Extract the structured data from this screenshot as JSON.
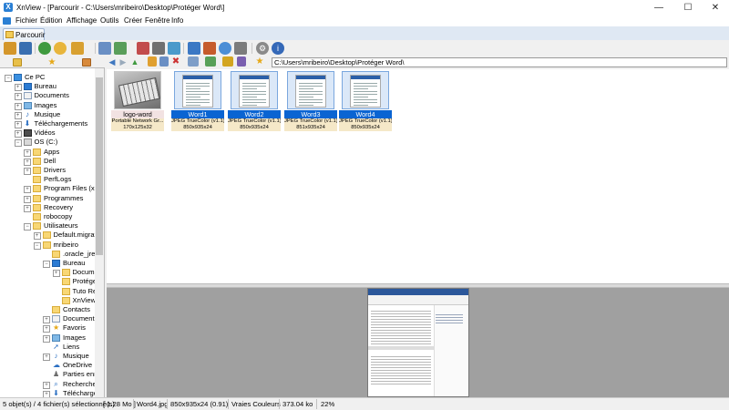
{
  "window": {
    "title": "XnView - [Parcourir - C:\\Users\\mribeiro\\Desktop\\Protéger Word\\]",
    "minimize_glyph": "—",
    "maximize_glyph": "☐",
    "close_glyph": "✕"
  },
  "menu": [
    "Fichier",
    "Édition",
    "Affichage",
    "Outils",
    "Créer",
    "Fenêtre",
    "Info"
  ],
  "tab": {
    "label": "Parcourir"
  },
  "address": {
    "path": "C:\\Users\\mribeiro\\Desktop\\Protéger Word\\"
  },
  "tree": [
    {
      "label": "Ce PC",
      "depth": 0,
      "icon": "computer-icon",
      "exp": "−"
    },
    {
      "label": "Bureau",
      "depth": 1,
      "icon": "desktop-icon",
      "exp": "+"
    },
    {
      "label": "Documents",
      "depth": 1,
      "icon": "documents-icon",
      "exp": "+"
    },
    {
      "label": "Images",
      "depth": 1,
      "icon": "images-icon",
      "exp": "+"
    },
    {
      "label": "Musique",
      "depth": 1,
      "icon": "music-icon",
      "exp": "+"
    },
    {
      "label": "Téléchargements",
      "depth": 1,
      "icon": "downloads-icon",
      "exp": "+"
    },
    {
      "label": "Vidéos",
      "depth": 1,
      "icon": "videos-icon",
      "exp": "+"
    },
    {
      "label": "OS (C:)",
      "depth": 1,
      "icon": "drive-icon",
      "exp": "−"
    },
    {
      "label": "Apps",
      "depth": 2,
      "icon": "folder-icon",
      "exp": "+"
    },
    {
      "label": "Dell",
      "depth": 2,
      "icon": "folder-icon",
      "exp": "+"
    },
    {
      "label": "Drivers",
      "depth": 2,
      "icon": "folder-icon",
      "exp": "+"
    },
    {
      "label": "PerfLogs",
      "depth": 2,
      "icon": "folder-icon",
      "exp": ""
    },
    {
      "label": "Program Files (x86",
      "depth": 2,
      "icon": "folder-icon",
      "exp": "+"
    },
    {
      "label": "Programmes",
      "depth": 2,
      "icon": "folder-icon",
      "exp": "+"
    },
    {
      "label": "Recovery",
      "depth": 2,
      "icon": "folder-icon",
      "exp": "+"
    },
    {
      "label": "robocopy",
      "depth": 2,
      "icon": "folder-icon",
      "exp": ""
    },
    {
      "label": "Utilisateurs",
      "depth": 2,
      "icon": "folder-icon",
      "exp": "−"
    },
    {
      "label": "Default.migrat",
      "depth": 3,
      "icon": "folder-icon",
      "exp": "+"
    },
    {
      "label": "mribeiro",
      "depth": 3,
      "icon": "folder-icon",
      "exp": "−"
    },
    {
      "label": ".oracle_jre_",
      "depth": 4,
      "icon": "folder-icon",
      "exp": ""
    },
    {
      "label": "Bureau",
      "depth": 4,
      "icon": "desktop-icon",
      "exp": "−"
    },
    {
      "label": "Docum",
      "depth": 5,
      "icon": "folder-icon",
      "exp": "+"
    },
    {
      "label": "Protége",
      "depth": 5,
      "icon": "folder-icon",
      "exp": ""
    },
    {
      "label": "Tuto Re",
      "depth": 5,
      "icon": "folder-icon",
      "exp": ""
    },
    {
      "label": "XnView",
      "depth": 5,
      "icon": "folder-icon",
      "exp": ""
    },
    {
      "label": "Contacts",
      "depth": 4,
      "icon": "contacts-icon",
      "exp": ""
    },
    {
      "label": "Documents",
      "depth": 4,
      "icon": "documents-icon",
      "exp": "+"
    },
    {
      "label": "Favoris",
      "depth": 4,
      "icon": "star-icon",
      "exp": "+"
    },
    {
      "label": "Images",
      "depth": 4,
      "icon": "images-icon",
      "exp": "+"
    },
    {
      "label": "Liens",
      "depth": 4,
      "icon": "links-icon",
      "exp": ""
    },
    {
      "label": "Musique",
      "depth": 4,
      "icon": "music-icon",
      "exp": "+"
    },
    {
      "label": "OneDrive",
      "depth": 4,
      "icon": "cloud-icon",
      "exp": ""
    },
    {
      "label": "Parties enre",
      "depth": 4,
      "icon": "saved-games-icon",
      "exp": ""
    },
    {
      "label": "Recherches",
      "depth": 4,
      "icon": "search-icon",
      "exp": "+"
    },
    {
      "label": "Téléchargem",
      "depth": 4,
      "icon": "downloads-icon",
      "exp": "+"
    }
  ],
  "thumbnails": [
    {
      "name": "logo-word",
      "type": "Portable Network Gr...",
      "dims": "170x125x32",
      "selected": false
    },
    {
      "name": "Word1",
      "type": "JPEG TrueColor (v1.1)",
      "dims": "850x935x24",
      "selected": true
    },
    {
      "name": "Word2",
      "type": "JPEG TrueColor (v1.1)",
      "dims": "850x935x24",
      "selected": true
    },
    {
      "name": "Word3",
      "type": "JPEG TrueColor (v1.1)",
      "dims": "851x935x24",
      "selected": true
    },
    {
      "name": "Word4",
      "type": "JPEG TrueColor (v1.1)",
      "dims": "850x935x24",
      "selected": true
    }
  ],
  "status": {
    "objects": "5 objet(s) / 4 fichier(s) sélectionné(s)",
    "size": "[ 1.28 Mo ]",
    "file": "Word4.jpg",
    "dims": "850x935x24 (0.91)",
    "colors": "Vraies Couleurs",
    "filesize": "373.04 ko",
    "zoom": "22%"
  },
  "colors": {
    "selection": "#0a64d2",
    "accent": "#2b7bd3",
    "folder": "#f8d775"
  }
}
